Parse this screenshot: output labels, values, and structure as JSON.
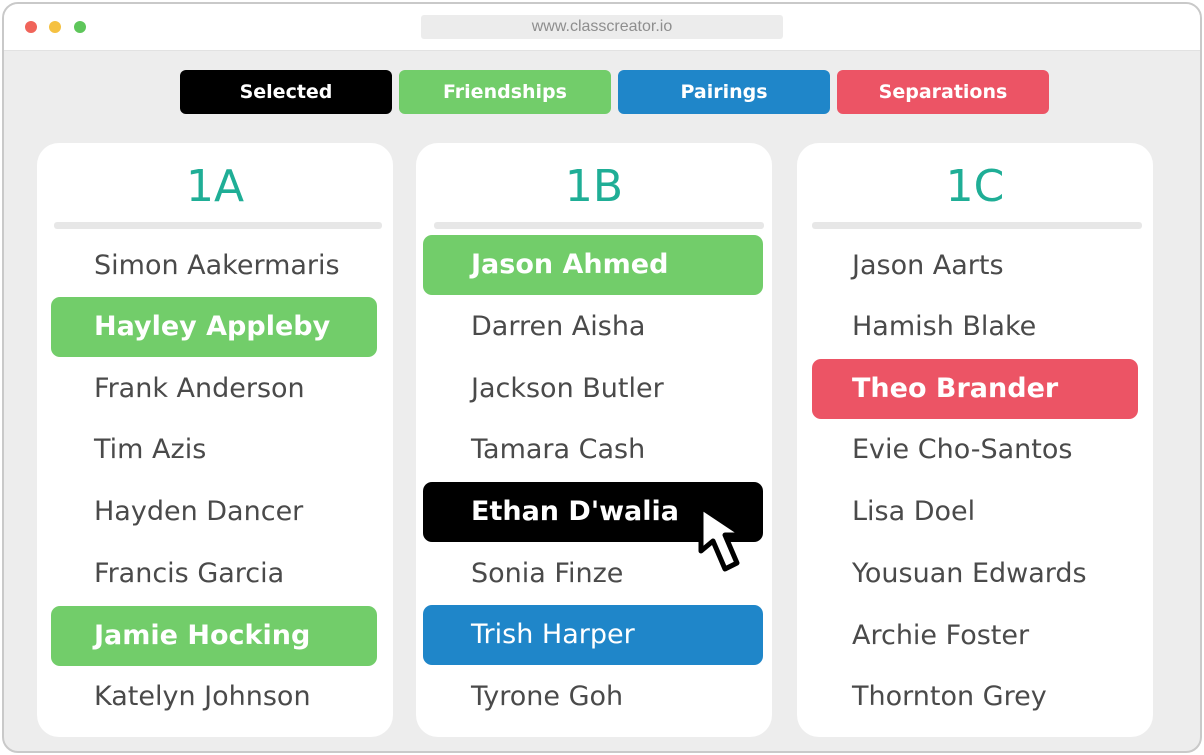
{
  "window": {
    "url": "www.classcreator.io"
  },
  "legend": {
    "selected": "Selected",
    "friendships": "Friendships",
    "pairings": "Pairings",
    "separations": "Separations"
  },
  "colors": {
    "accent_teal": "#1fae96",
    "selected": "#000000",
    "friendships": "#72cd6a",
    "pairings": "#1f86c9",
    "separations": "#ec5465"
  },
  "classes": [
    {
      "name": "1A",
      "students": [
        {
          "name": "Simon Aakermaris",
          "status": "none"
        },
        {
          "name": "Hayley Appleby",
          "status": "friendship"
        },
        {
          "name": "Frank Anderson",
          "status": "none"
        },
        {
          "name": "Tim Azis",
          "status": "none"
        },
        {
          "name": "Hayden Dancer",
          "status": "none"
        },
        {
          "name": "Francis Garcia",
          "status": "none"
        },
        {
          "name": "Jamie Hocking",
          "status": "friendship"
        },
        {
          "name": "Katelyn Johnson",
          "status": "none"
        }
      ]
    },
    {
      "name": "1B",
      "students": [
        {
          "name": "Jason Ahmed",
          "status": "friendship"
        },
        {
          "name": "Darren Aisha",
          "status": "none"
        },
        {
          "name": "Jackson Butler",
          "status": "none"
        },
        {
          "name": "Tamara Cash",
          "status": "none"
        },
        {
          "name": "Ethan D'walia",
          "status": "selected"
        },
        {
          "name": "Sonia Finze",
          "status": "none"
        },
        {
          "name": "Trish Harper",
          "status": "pairing"
        },
        {
          "name": "Tyrone Goh",
          "status": "none"
        }
      ]
    },
    {
      "name": "1C",
      "students": [
        {
          "name": "Jason Aarts",
          "status": "none"
        },
        {
          "name": "Hamish Blake",
          "status": "none"
        },
        {
          "name": "Theo Brander",
          "status": "separation"
        },
        {
          "name": "Evie Cho-Santos",
          "status": "none"
        },
        {
          "name": "Lisa Doel",
          "status": "none"
        },
        {
          "name": "Yousuan Edwards",
          "status": "none"
        },
        {
          "name": "Archie Foster",
          "status": "none"
        },
        {
          "name": "Thornton Grey",
          "status": "none"
        }
      ]
    }
  ],
  "icons": {
    "window_controls": [
      "close-dot",
      "minimize-dot",
      "zoom-dot"
    ],
    "pointer": "mouse-pointer-icon"
  }
}
